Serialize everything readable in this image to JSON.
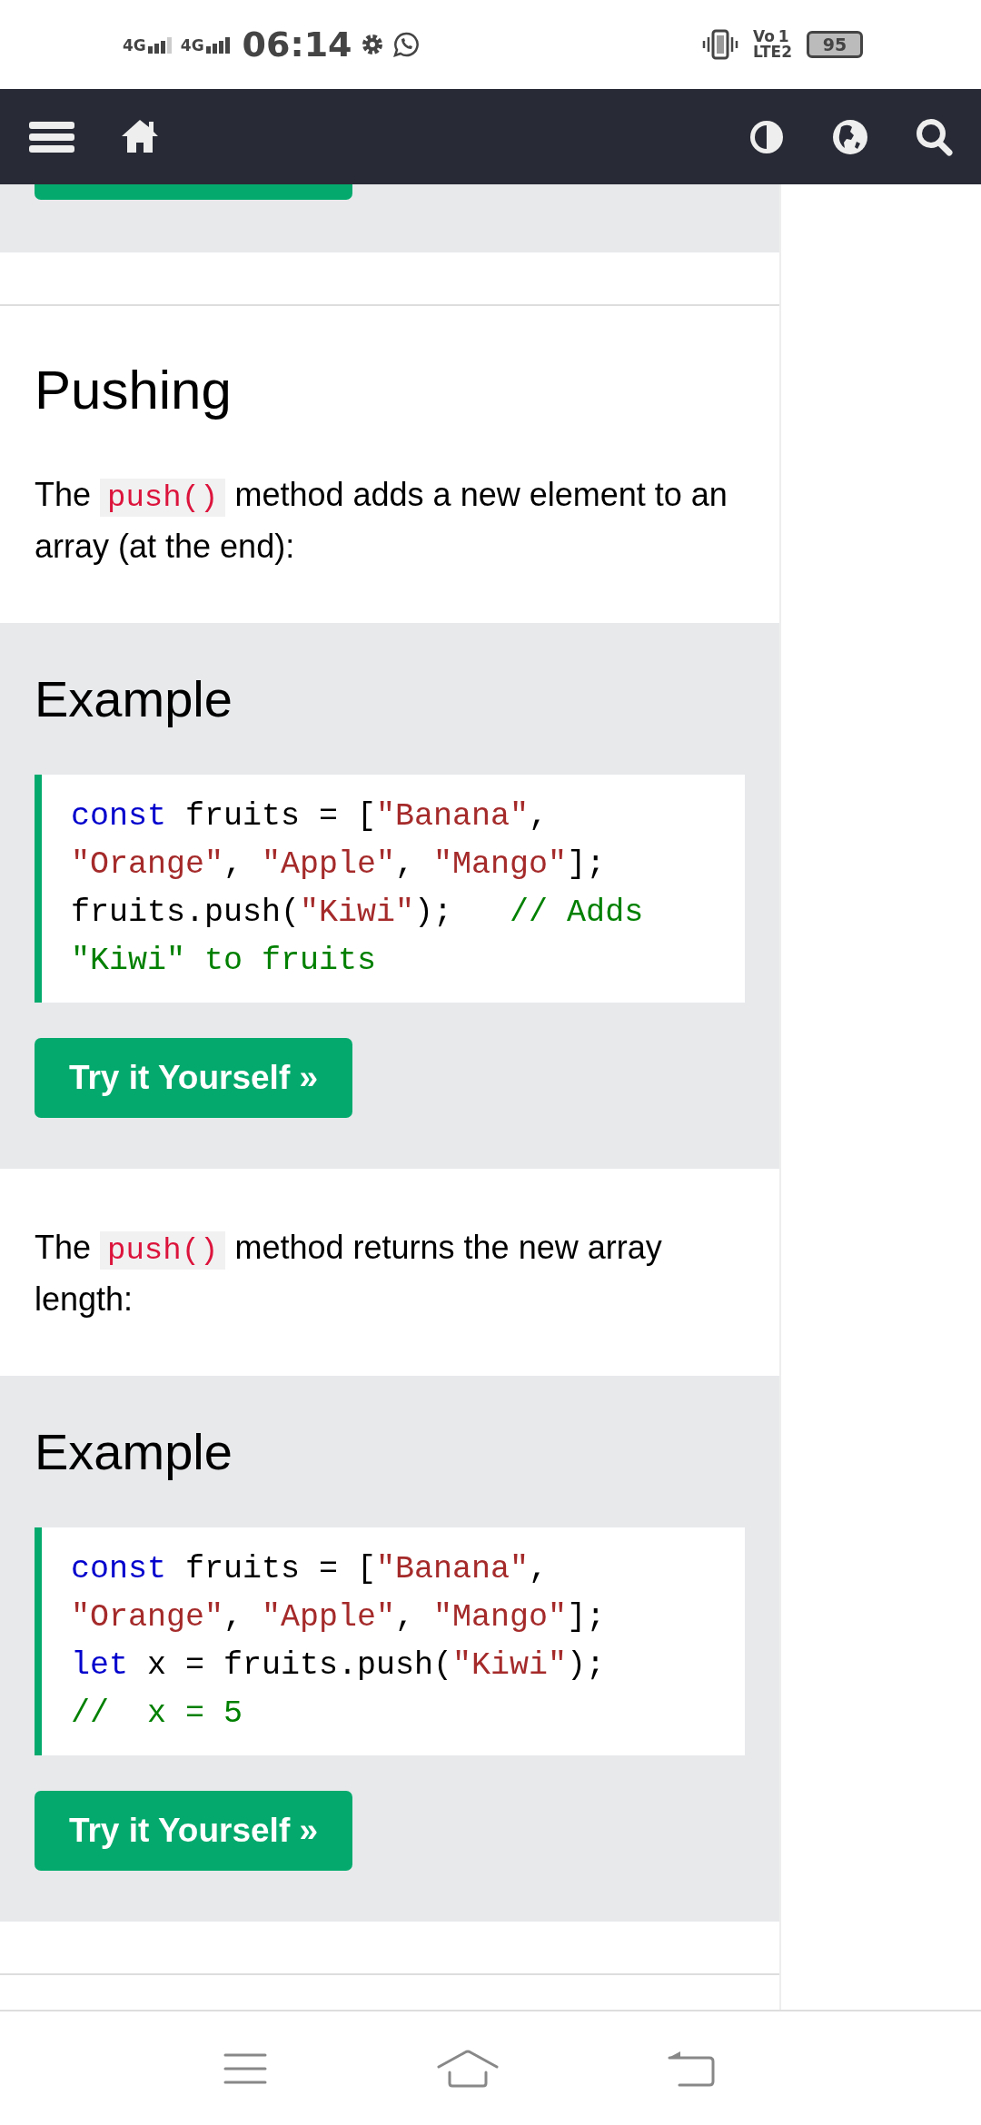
{
  "status_bar": {
    "networks": [
      {
        "label": "4G"
      },
      {
        "label": "4G"
      }
    ],
    "time": "06:14",
    "volte": {
      "label": "Vo",
      "sim": "1",
      "lte": "LTE2"
    },
    "battery": "95"
  },
  "sections": [
    {
      "kind": "partial"
    },
    {
      "kind": "gap"
    },
    {
      "kind": "text",
      "heading": "Pushing",
      "paragraph": [
        {
          "t": "The ",
          "kind": "text"
        },
        {
          "t": "push()",
          "kind": "code"
        },
        {
          "t": " method adds a new element to an array (at the end):",
          "kind": "text"
        }
      ]
    },
    {
      "kind": "example",
      "heading": "Example",
      "code": [
        [
          {
            "t": "const",
            "kind": "keyword"
          },
          {
            "t": " fruits = [",
            "kind": "plain"
          },
          {
            "t": "\"Banana\"",
            "kind": "string"
          },
          {
            "t": ",",
            "kind": "plain"
          }
        ],
        [
          {
            "t": "\"Orange\"",
            "kind": "string"
          },
          {
            "t": ", ",
            "kind": "plain"
          },
          {
            "t": "\"Apple\"",
            "kind": "string"
          },
          {
            "t": ", ",
            "kind": "plain"
          },
          {
            "t": "\"Mango\"",
            "kind": "string"
          },
          {
            "t": "];",
            "kind": "plain"
          }
        ],
        [
          {
            "t": "fruits.push(",
            "kind": "plain"
          },
          {
            "t": "\"Kiwi\"",
            "kind": "string"
          },
          {
            "t": ");   ",
            "kind": "plain"
          },
          {
            "t": "// Adds",
            "kind": "comment"
          }
        ],
        [
          {
            "t": "\"Kiwi\" to fruits",
            "kind": "comment"
          }
        ]
      ],
      "button": "Try it Yourself »"
    },
    {
      "kind": "text",
      "paragraph": [
        {
          "t": "The ",
          "kind": "text"
        },
        {
          "t": "push()",
          "kind": "code"
        },
        {
          "t": " method returns the new array length:",
          "kind": "text"
        }
      ]
    },
    {
      "kind": "example",
      "heading": "Example",
      "code": [
        [
          {
            "t": "const",
            "kind": "keyword"
          },
          {
            "t": " fruits = [",
            "kind": "plain"
          },
          {
            "t": "\"Banana\"",
            "kind": "string"
          },
          {
            "t": ",",
            "kind": "plain"
          }
        ],
        [
          {
            "t": "\"Orange\"",
            "kind": "string"
          },
          {
            "t": ", ",
            "kind": "plain"
          },
          {
            "t": "\"Apple\"",
            "kind": "string"
          },
          {
            "t": ", ",
            "kind": "plain"
          },
          {
            "t": "\"Mango\"",
            "kind": "string"
          },
          {
            "t": "];",
            "kind": "plain"
          }
        ],
        [
          {
            "t": "let",
            "kind": "keyword"
          },
          {
            "t": " x = fruits.push(",
            "kind": "plain"
          },
          {
            "t": "\"Kiwi\"",
            "kind": "string"
          },
          {
            "t": ");",
            "kind": "plain"
          }
        ],
        [
          {
            "t": "//  x = 5",
            "kind": "comment"
          }
        ]
      ],
      "button": "Try it Yourself »"
    },
    {
      "kind": "gap"
    }
  ]
}
